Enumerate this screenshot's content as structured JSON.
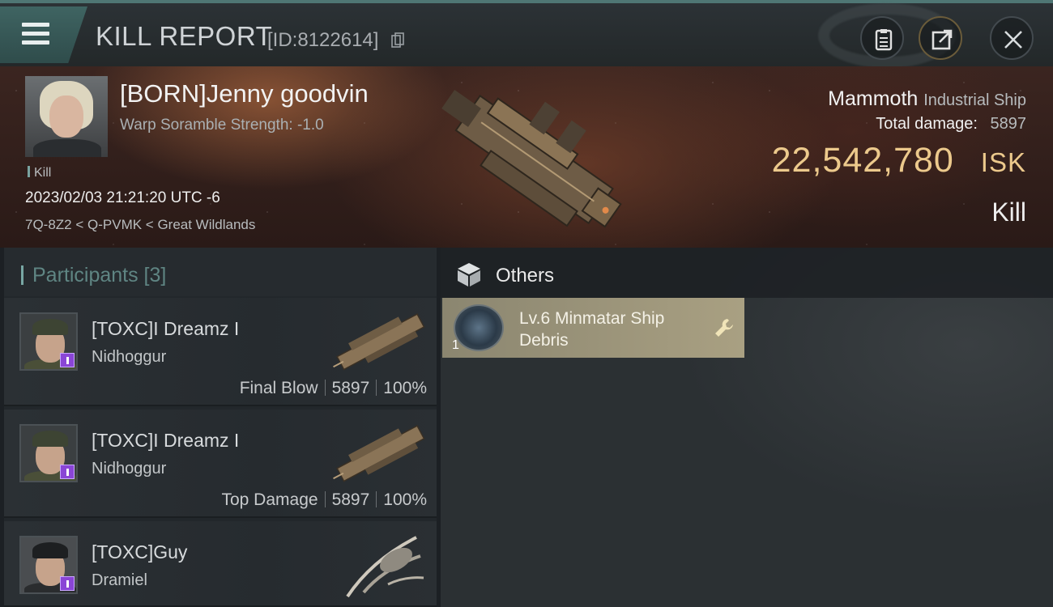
{
  "header": {
    "title": "KILL REPORT",
    "report_id": "[ID:8122614]"
  },
  "victim": {
    "name": "[BORN]Jenny goodvin",
    "warp_scramble": "Warp Soramble Strength: -1.0",
    "tag": "Kill",
    "timestamp": "2023/02/03 21:21:20 UTC -6",
    "location": "7Q-8Z2 < Q-PVMK < Great Wildlands",
    "ship_name": "Mammoth",
    "ship_class": "Industrial Ship",
    "total_damage_label": "Total damage:",
    "total_damage_value": "5897",
    "isk_value": "22,542,780",
    "isk_unit": "ISK",
    "result": "Kill"
  },
  "participants": {
    "title": "Participants [3]",
    "rows": [
      {
        "name": "[TOXC]I Dreamz I",
        "ship": "Nidhoggur",
        "role": "Final Blow",
        "damage": "5897",
        "percent": "100%"
      },
      {
        "name": "[TOXC]I Dreamz I",
        "ship": "Nidhoggur",
        "role": "Top Damage",
        "damage": "5897",
        "percent": "100%"
      },
      {
        "name": "[TOXC]Guy",
        "ship": "Dramiel",
        "role": "",
        "damage": "",
        "percent": ""
      }
    ]
  },
  "others": {
    "title": "Others",
    "items": [
      {
        "name": "Lv.6 Minmatar Ship Debris",
        "quantity": "1"
      }
    ]
  },
  "colors": {
    "accent": "#4f7674",
    "isk": "#ecc98c",
    "item_card": "#a9a082",
    "corp_badge": "#8a45d6"
  }
}
